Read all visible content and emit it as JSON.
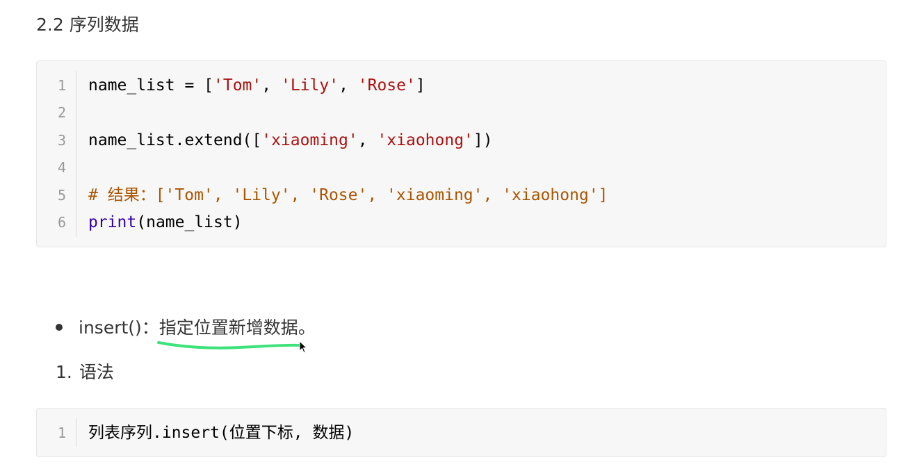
{
  "heading": "2.2 序列数据",
  "code_block_1": {
    "lines": [
      {
        "num": "1",
        "tokens": [
          {
            "t": "name_list = [",
            "c": "plain"
          },
          {
            "t": "'Tom'",
            "c": "str"
          },
          {
            "t": ", ",
            "c": "plain"
          },
          {
            "t": "'Lily'",
            "c": "str"
          },
          {
            "t": ", ",
            "c": "plain"
          },
          {
            "t": "'Rose'",
            "c": "str"
          },
          {
            "t": "]",
            "c": "plain"
          }
        ]
      },
      {
        "num": "2",
        "tokens": []
      },
      {
        "num": "3",
        "tokens": [
          {
            "t": "name_list.extend([",
            "c": "plain"
          },
          {
            "t": "'xiaoming'",
            "c": "str"
          },
          {
            "t": ", ",
            "c": "plain"
          },
          {
            "t": "'xiaohong'",
            "c": "str"
          },
          {
            "t": "])",
            "c": "plain"
          }
        ]
      },
      {
        "num": "4",
        "tokens": []
      },
      {
        "num": "5",
        "tokens": [
          {
            "t": "# 结果：['Tom', 'Lily', 'Rose', 'xiaoming', 'xiaohong']",
            "c": "comment"
          }
        ]
      },
      {
        "num": "6",
        "tokens": [
          {
            "t": "print",
            "c": "kw"
          },
          {
            "t": "(name_list)",
            "c": "plain"
          }
        ]
      }
    ]
  },
  "bullet": {
    "prefix": "insert()：",
    "highlighted": "指定位置新增数据",
    "suffix": "。"
  },
  "ordered_item": {
    "number": "1.",
    "text": "语法"
  },
  "code_block_2": {
    "lines": [
      {
        "num": "1",
        "tokens": [
          {
            "t": "列表序列.insert(位置下标, 数据)",
            "c": "plain"
          }
        ]
      }
    ]
  },
  "colors": {
    "string": "#aa1111",
    "comment": "#aa5500",
    "keyword": "#3300aa",
    "annotation_underline": "#3de27a"
  }
}
